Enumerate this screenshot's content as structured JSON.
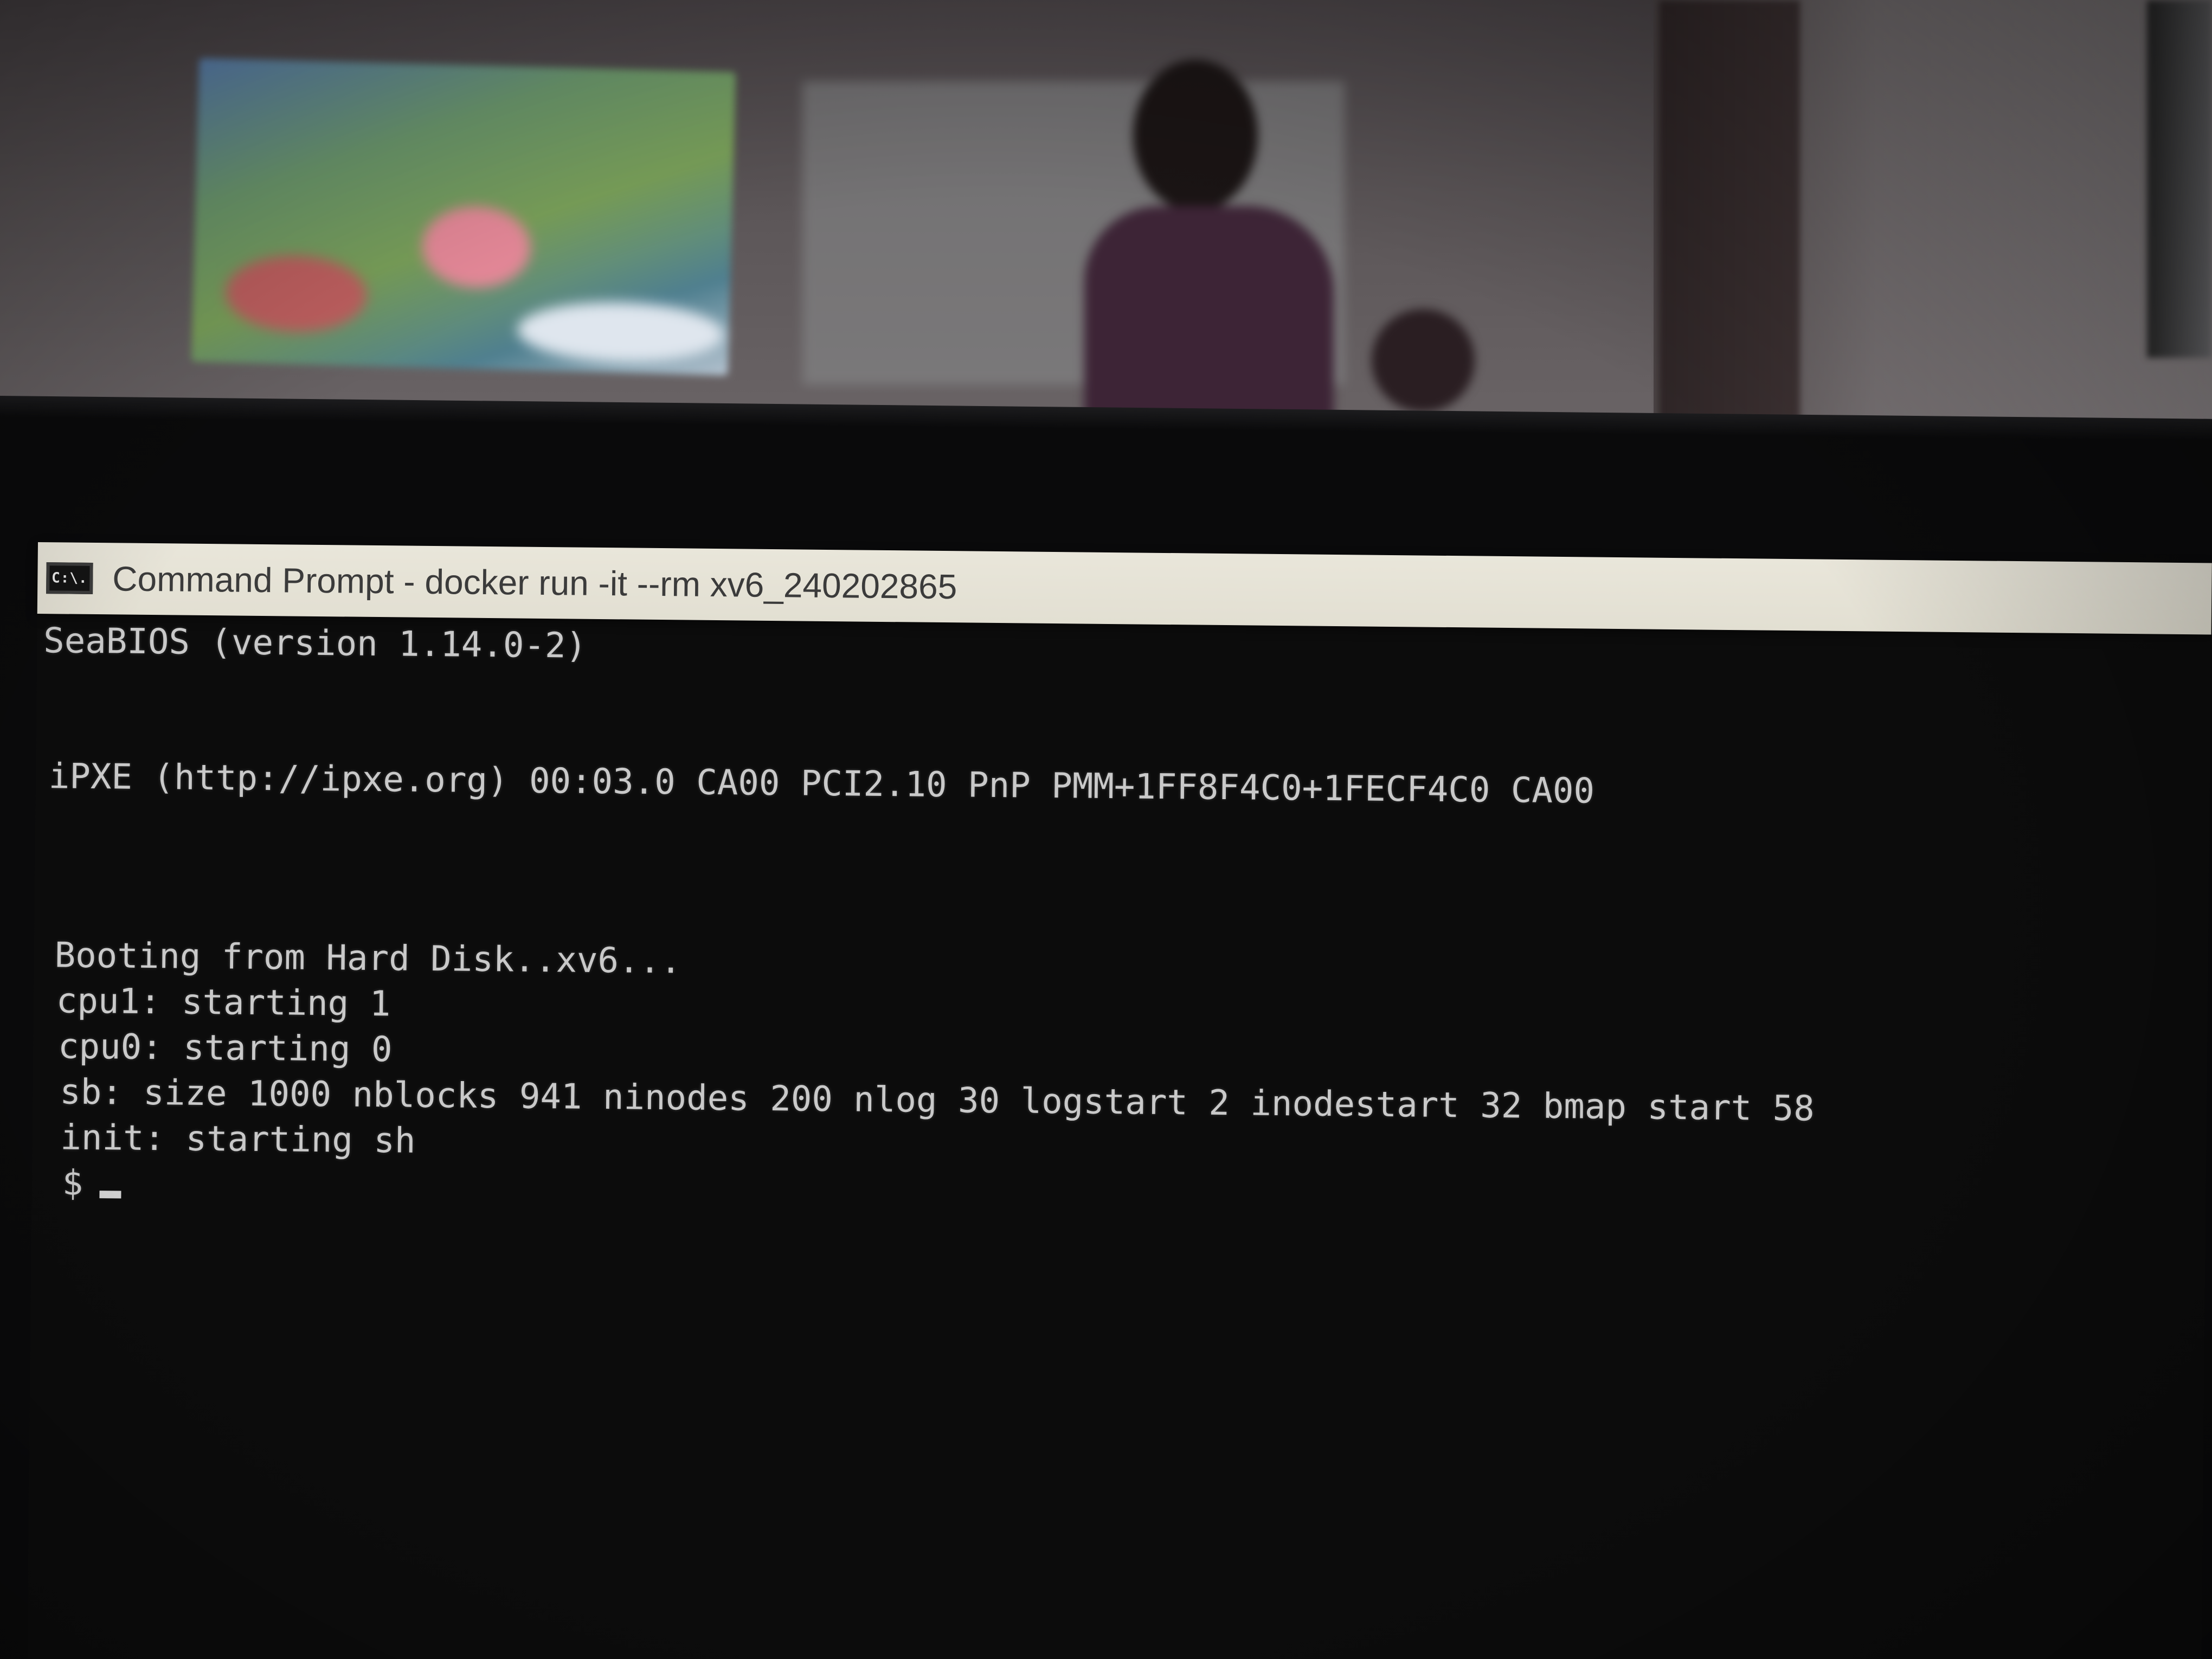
{
  "window": {
    "icon_label": "C:\\.",
    "title": "Command Prompt - docker  run -it --rm xv6_240202865"
  },
  "console": {
    "lines": [
      "SeaBIOS (version 1.14.0-2)",
      "iPXE (http://ipxe.org) 00:03.0 CA00 PCI2.10 PnP PMM+1FF8F4C0+1FECF4C0 CA00",
      "Booting from Hard Disk..xv6...",
      "cpu1: starting 1",
      "cpu0: starting 0",
      "sb: size 1000 nblocks 941 ninodes 200 nlog 30 logstart 2 inodestart 32 bmap start 58",
      "init: starting sh"
    ],
    "prompt": "$"
  },
  "colors": {
    "console_background": "#0c0c0c",
    "console_text": "#c9c9c9",
    "title_bar": "#e9e6da"
  },
  "icons": {
    "window_icon": "command-prompt-icon"
  }
}
